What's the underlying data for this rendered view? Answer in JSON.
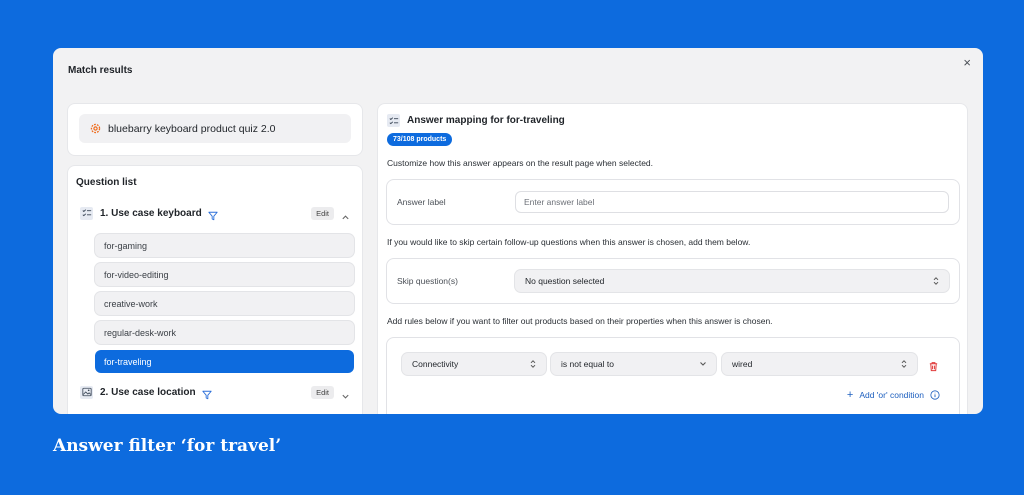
{
  "modal": {
    "title": "Match results",
    "close_glyph": "×"
  },
  "quiz": {
    "name": "bluebarry keyboard product quiz 2.0",
    "icon": "gear-icon",
    "icon_color": "#ef6a1a"
  },
  "question_list": {
    "title": "Question list",
    "q1": {
      "title": "1. Use case keyboard",
      "edit_label": "Edit"
    },
    "answers": [
      "for-gaming",
      "for-video-editing",
      "creative-work",
      "regular-desk-work",
      "for-traveling"
    ],
    "q2": {
      "title": "2. Use case location",
      "edit_label": "Edit"
    }
  },
  "mapping": {
    "title": "Answer mapping for for-traveling",
    "badge": "73/108 products",
    "intro": "Customize how this answer appears on the result page when selected.",
    "answer_label": {
      "label": "Answer label",
      "placeholder": "Enter answer label",
      "value": ""
    },
    "skip_intro": "If you would like to skip certain follow-up questions when this answer is chosen, add them below.",
    "skip": {
      "label": "Skip question(s)",
      "value": "No question selected"
    },
    "rules_intro": "Add rules below if you want to filter out products based on their properties when this answer is chosen.",
    "rule": {
      "property": "Connectivity",
      "operator": "is not equal to",
      "value": "wired"
    },
    "add_or": "Add 'or' condition"
  },
  "caption": "Answer filter ‘for travel’",
  "colors": {
    "background": "#0d6bde",
    "accent": "#0d6bde",
    "danger": "#e03a3a",
    "link": "#1d5fbf"
  }
}
